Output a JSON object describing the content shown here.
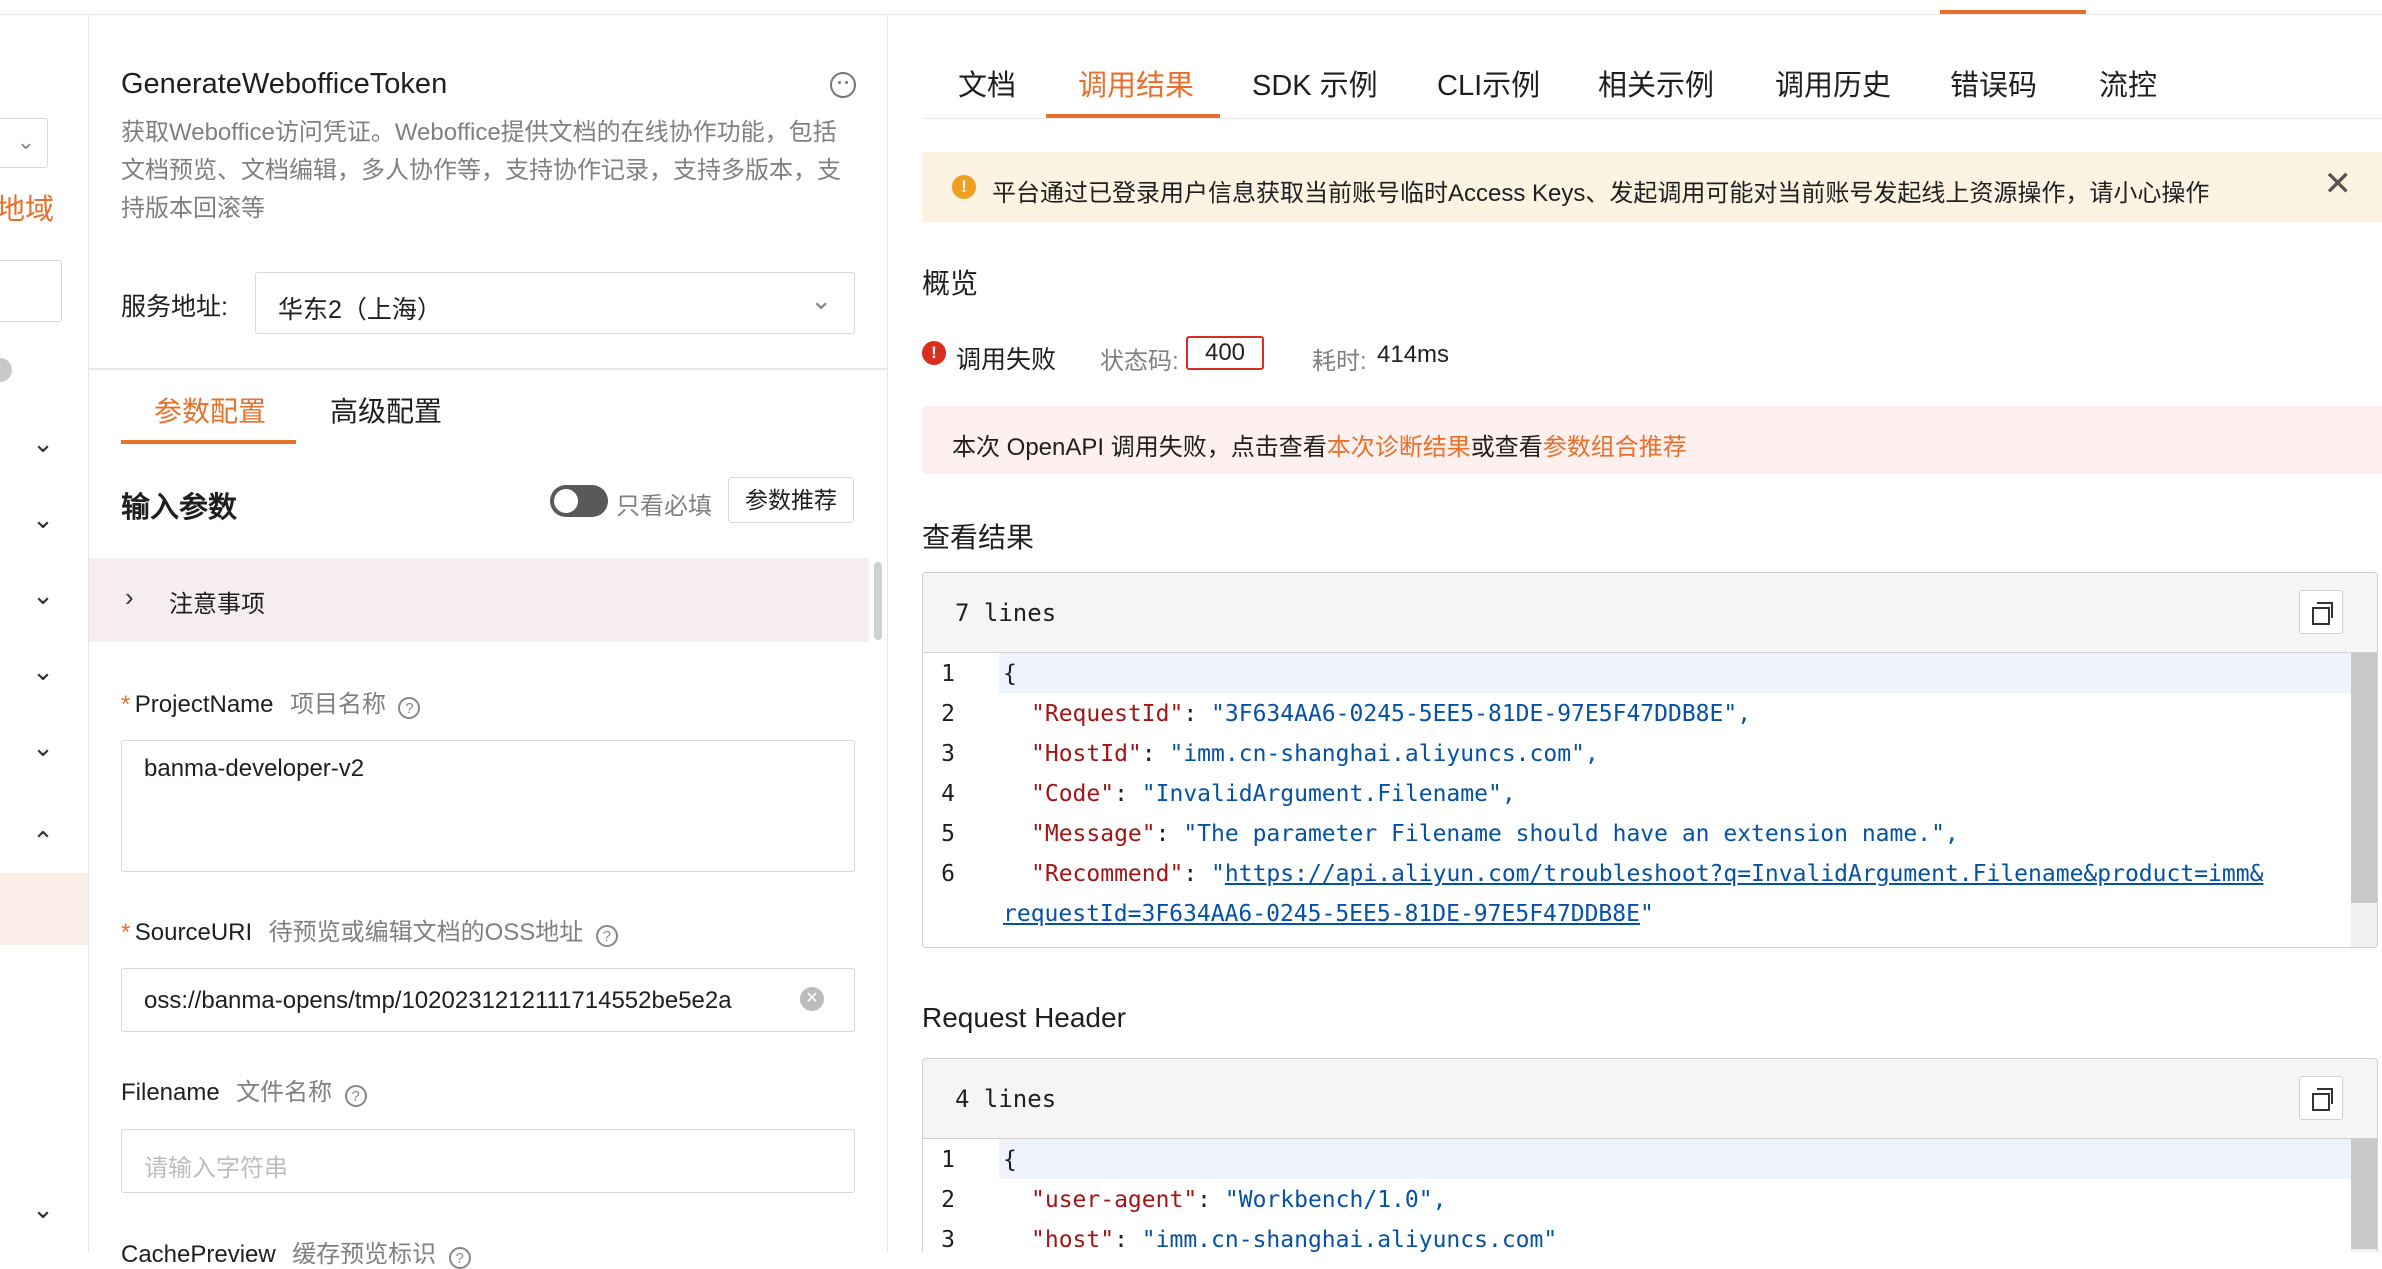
{
  "nav": {
    "region_label": "地域",
    "chevron_down": "⌄",
    "chevron_up": "⌃"
  },
  "api": {
    "title": "GenerateWebofficeToken",
    "description": "获取Weboffice访问凭证。Weboffice提供文档的在线协作功能，包括文档预览、文档编辑，多人协作等，支持协作记录，支持多版本，支持版本回滚等"
  },
  "service": {
    "label": "服务地址:",
    "value": "华东2（上海）"
  },
  "config_tabs": {
    "params": "参数配置",
    "advanced": "高级配置"
  },
  "input_params": {
    "title": "输入参数",
    "only_required": "只看必填",
    "recommend_button": "参数推荐",
    "notice": "注意事项"
  },
  "fields": {
    "project_name": {
      "star": "*",
      "label": "ProjectName",
      "sublabel": "项目名称",
      "help": "?",
      "value": "banma-developer-v2"
    },
    "source_uri": {
      "star": "*",
      "label": "SourceURI",
      "sublabel": "待预览或编辑文档的OSS地址",
      "help": "?",
      "value": "oss://banma-opens/tmp/10202312121117145​52be5e2a"
    },
    "filename": {
      "label": "Filename",
      "sublabel": "文件名称",
      "help": "?",
      "placeholder": "请输入字符串"
    },
    "cache_preview": {
      "label": "CachePreview",
      "sublabel": "缓存预览标识",
      "help": "?"
    }
  },
  "result_tabs": [
    {
      "label": "文档",
      "active": false
    },
    {
      "label": "调用结果",
      "active": true
    },
    {
      "label": "SDK 示例",
      "active": false
    },
    {
      "label": "CLI示例",
      "active": false
    },
    {
      "label": "相关示例",
      "active": false
    },
    {
      "label": "调用历史",
      "active": false
    },
    {
      "label": "错误码",
      "active": false
    },
    {
      "label": "流控",
      "active": false
    }
  ],
  "warning": {
    "icon": "!",
    "text": "平台通过已登录用户信息获取当前账号临时Access Keys、发起调用可能对当前账号发起线上资源操作，请小心操作",
    "close": "✕"
  },
  "overview": {
    "title": "概览",
    "fail_icon": "!",
    "fail_text": "调用失败",
    "status_label": "状态码:",
    "status_code": "400",
    "time_label": "耗时:",
    "time_value": "414ms"
  },
  "error_box": {
    "prefix": "本次 OpenAPI 调用失败，点击查看",
    "link1": "本次诊断结果",
    "middle": "或查看",
    "link2": "参数组合推荐"
  },
  "result": {
    "title": "查看结果",
    "line_count": "7 lines",
    "line_numbers": [
      "1",
      "2",
      "3",
      "4",
      "5",
      "6"
    ],
    "open_brace": "{",
    "entries": [
      {
        "key": "\"RequestId\"",
        "value": "\"3F634AA6-0245-5EE5-81DE-97E5F47DDB8E\","
      },
      {
        "key": "\"HostId\"",
        "value": "\"imm.cn-shanghai.aliyuncs.com\","
      },
      {
        "key": "\"Code\"",
        "value": "\"InvalidArgument.Filename\","
      },
      {
        "key": "\"Message\"",
        "value": "\"The parameter Filename should have an extension name.\","
      }
    ],
    "recommend_key": "\"Recommend\"",
    "recommend_quote": "\"",
    "recommend_url_1": "https://api.aliyun.com/troubleshoot?q=InvalidArgument.Filename&product=imm&",
    "recommend_url_2": "requestId=3F634AA6-0245-5EE5-81DE-97E5F47DDB8E",
    "recommend_end": "\""
  },
  "request_header": {
    "title": "Request Header",
    "line_count": "4 lines",
    "line_numbers": [
      "1",
      "2",
      "3"
    ],
    "open_brace": "{",
    "entries": [
      {
        "key": "\"user-agent\"",
        "value": "\"Workbench/1.0\","
      },
      {
        "key": "\"host\"",
        "value": "\"imm.cn-shanghai.aliyuncs.com\""
      }
    ]
  },
  "colors": {
    "accent": "#e8702a",
    "error": "#d92d20",
    "warning": "#f0a020",
    "json_key": "#a31515",
    "json_string": "#0451a5"
  }
}
